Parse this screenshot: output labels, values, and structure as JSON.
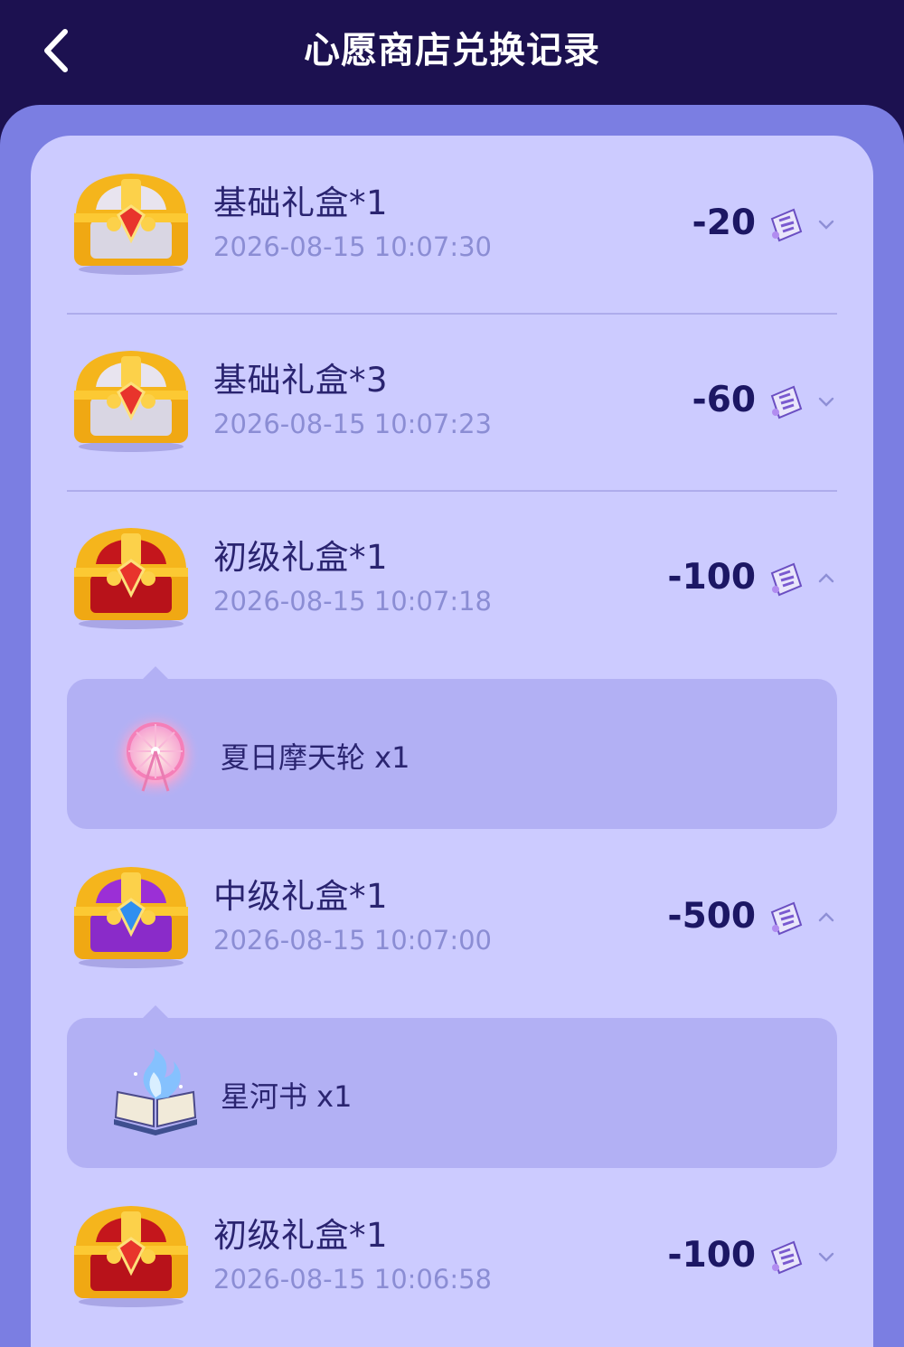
{
  "header": {
    "title": "心愿商店兑换记录"
  },
  "records": [
    {
      "title": "基础礼盒*1",
      "time": "2026-08-15 10:07:30",
      "amount": "-20",
      "expanded": false,
      "chest": "basic-chest-icon"
    },
    {
      "title": "基础礼盒*3",
      "time": "2026-08-15 10:07:23",
      "amount": "-60",
      "expanded": false,
      "chest": "basic-chest-icon"
    },
    {
      "title": "初级礼盒*1",
      "time": "2026-08-15 10:07:18",
      "amount": "-100",
      "expanded": true,
      "chest": "junior-chest-icon",
      "prize": {
        "label": "夏日摩天轮 x1",
        "icon": "ferris-wheel-icon"
      }
    },
    {
      "title": "中级礼盒*1",
      "time": "2026-08-15 10:07:00",
      "amount": "-500",
      "expanded": true,
      "chest": "intermediate-chest-icon",
      "prize": {
        "label": "星河书 x1",
        "icon": "galaxy-book-icon"
      }
    },
    {
      "title": "初级礼盒*1",
      "time": "2026-08-15 10:06:58",
      "amount": "-100",
      "expanded": false,
      "chest": "junior-chest-icon"
    }
  ],
  "colors": {
    "header_bg": "#1c1150",
    "panel_bg": "#7b7ee2",
    "card_bg": "#cccbff",
    "detail_bg": "#b2b0f4",
    "amount_text": "#1c1764",
    "time_text": "#8b8dd4"
  }
}
